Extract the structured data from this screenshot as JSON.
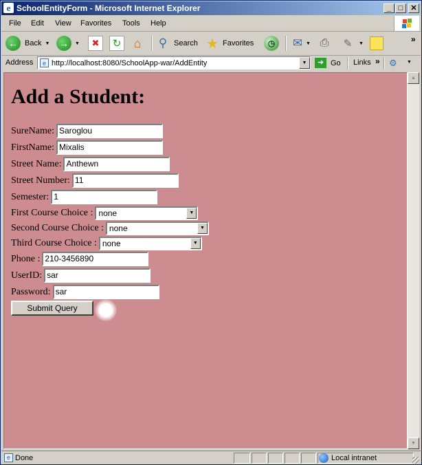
{
  "window": {
    "title": "SchoolEntityForm - Microsoft Internet Explorer",
    "controls": {
      "minimize": "_",
      "maximize": "□",
      "close": "✕"
    }
  },
  "menu": {
    "items": [
      "File",
      "Edit",
      "View",
      "Favorites",
      "Tools",
      "Help"
    ]
  },
  "toolbar": {
    "back_label": "Back",
    "search_label": "Search",
    "favorites_label": "Favorites"
  },
  "address_bar": {
    "label": "Address",
    "url": "http://localhost:8080/SchoolApp-war/AddEntity",
    "go_label": "Go",
    "links_label": "Links"
  },
  "form": {
    "heading": "Add a Student:",
    "fields": {
      "surname": {
        "label": "SureName:",
        "value": "Saroglou"
      },
      "firstname": {
        "label": "FirstName:",
        "value": "Mixalis"
      },
      "street_name": {
        "label": "Street Name:",
        "value": "Anthewn"
      },
      "street_number": {
        "label": "Street Number:",
        "value": "11"
      },
      "semester": {
        "label": "Semester:",
        "value": "1"
      },
      "first_course": {
        "label": "First Course Choice :",
        "value": "none"
      },
      "second_course": {
        "label": "Second Course Choice :",
        "value": "none"
      },
      "third_course": {
        "label": "Third Course Choice :",
        "value": "none"
      },
      "phone": {
        "label": "Phone :",
        "value": "210-3456890"
      },
      "userid": {
        "label": "UserID:",
        "value": "sar"
      },
      "password": {
        "label": "Password:",
        "value": "sar"
      }
    },
    "submit_label": "Submit Query"
  },
  "colors": {
    "page_background": "#cd8c90",
    "titlebar_start": "#0a246a",
    "titlebar_end": "#a6caf0",
    "chrome": "#d4d0c8"
  },
  "status_bar": {
    "text": "Done",
    "zone": "Local intranet"
  }
}
